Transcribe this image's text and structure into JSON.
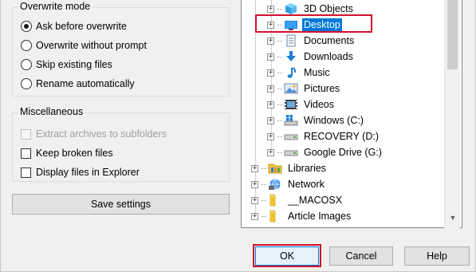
{
  "overwrite_mode": {
    "title": "Overwrite mode",
    "options": [
      {
        "label": "Ask before overwrite",
        "checked": true
      },
      {
        "label": "Overwrite without prompt",
        "checked": false
      },
      {
        "label": "Skip existing files",
        "checked": false
      },
      {
        "label": "Rename automatically",
        "checked": false
      }
    ]
  },
  "miscellaneous": {
    "title": "Miscellaneous",
    "options": [
      {
        "label": "Extract archives to subfolders",
        "checked": false,
        "disabled": true
      },
      {
        "label": "Keep broken files",
        "checked": false,
        "disabled": false
      },
      {
        "label": "Display files in Explorer",
        "checked": false,
        "disabled": false
      }
    ]
  },
  "save_settings_label": "Save settings",
  "tree": {
    "items": [
      {
        "label": "3D Objects",
        "icon": "3d-objects-icon"
      },
      {
        "label": "Desktop",
        "icon": "desktop-icon",
        "selected": true
      },
      {
        "label": "Documents",
        "icon": "documents-icon"
      },
      {
        "label": "Downloads",
        "icon": "downloads-icon"
      },
      {
        "label": "Music",
        "icon": "music-icon"
      },
      {
        "label": "Pictures",
        "icon": "pictures-icon"
      },
      {
        "label": "Videos",
        "icon": "videos-icon"
      },
      {
        "label": "Windows (C:)",
        "icon": "windows-drive-icon"
      },
      {
        "label": "RECOVERY (D:)",
        "icon": "drive-icon"
      },
      {
        "label": "Google Drive (G:)",
        "icon": "drive-icon"
      },
      {
        "label": "Libraries",
        "icon": "libraries-icon"
      },
      {
        "label": "Network",
        "icon": "network-icon"
      },
      {
        "label": "__MACOSX",
        "icon": "folder-icon"
      },
      {
        "label": "Article Images",
        "icon": "folder-icon"
      }
    ]
  },
  "buttons": {
    "ok": "OK",
    "cancel": "Cancel",
    "help": "Help"
  },
  "colors": {
    "selection": "#0078d7",
    "highlight": "#d3122a"
  }
}
